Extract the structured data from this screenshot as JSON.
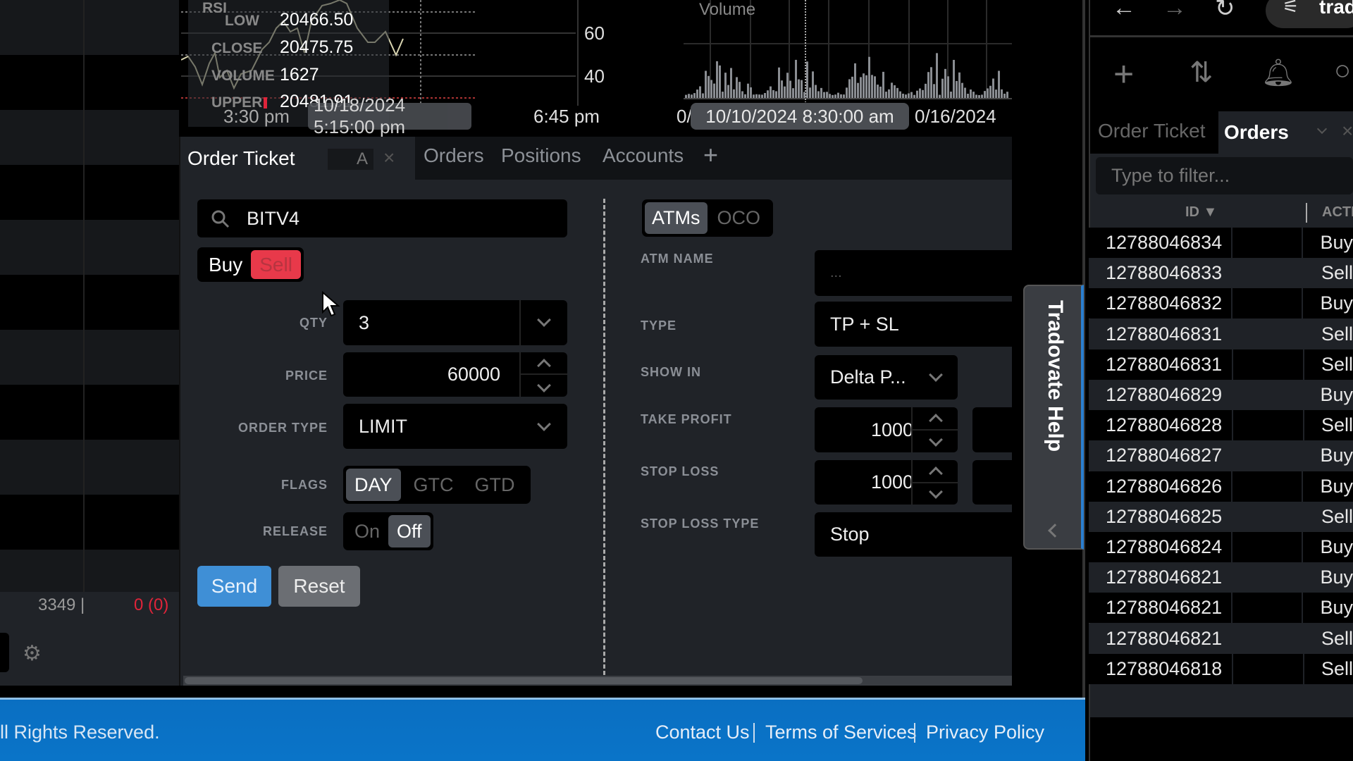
{
  "chart_rsi": {
    "title": "RSI",
    "legend": [
      {
        "label": "LOW",
        "value": "20466.50"
      },
      {
        "label": "CLOSE",
        "value": "20475.75"
      },
      {
        "label": "VOLUME",
        "value": "1627"
      },
      {
        "label": "UPPER",
        "value": "20481.91"
      }
    ],
    "y_ticks": [
      "60",
      "40"
    ],
    "x_ticks": [
      "3:30 pm",
      "6:45 pm"
    ],
    "crosshair_label": "10/18/2024 5:15:00 pm"
  },
  "chart_volume": {
    "title": "Volume",
    "x_ticks": [
      "0/",
      "0/16/2024"
    ],
    "crosshair_label": "10/10/2024 8:30:00 am"
  },
  "left_panel": {
    "count": "3349 |",
    "pnl": "0 (0)",
    "pnl_color": "#e0243a"
  },
  "order_panel": {
    "tabs": [
      {
        "label": "Order Ticket",
        "active": true
      },
      {
        "label": "Orders"
      },
      {
        "label": "Positions"
      },
      {
        "label": "Accounts"
      }
    ],
    "tab_badge": "A",
    "add_tab": "+",
    "close_tab": "×",
    "symbol": "BITV4",
    "side": {
      "buy": "Buy",
      "sell": "Sell",
      "selected": "Sell",
      "sell_color": "#e8394a"
    },
    "qty": {
      "label": "QTY",
      "value": "3"
    },
    "price": {
      "label": "PRICE",
      "value": "60000"
    },
    "order_type": {
      "label": "ORDER TYPE",
      "value": "LIMIT"
    },
    "flags": {
      "label": "FLAGS",
      "options": [
        "DAY",
        "GTC",
        "GTD"
      ],
      "selected": "DAY"
    },
    "release": {
      "label": "RELEASE",
      "options": [
        "On",
        "Off"
      ],
      "selected": "Off"
    },
    "send": "Send",
    "reset": "Reset",
    "send_color": "#3f8fd6"
  },
  "atm": {
    "toggle": [
      "ATMs",
      "OCO"
    ],
    "selected": "ATMs",
    "atm_name": {
      "label": "ATM NAME",
      "placeholder": "..."
    },
    "type": {
      "label": "TYPE",
      "value": "TP + SL"
    },
    "show_in": {
      "label": "SHOW IN",
      "value": "Delta P..."
    },
    "take_profit": {
      "label": "TAKE PROFIT",
      "value": "1000"
    },
    "stop_loss": {
      "label": "STOP LOSS",
      "value": "1000"
    },
    "stop_loss_type": {
      "label": "STOP LOSS TYPE",
      "value": "Stop"
    }
  },
  "help_tab": {
    "label": "Tradovate Help"
  },
  "footer": {
    "copyright": "ll Rights Reserved.",
    "links": [
      "Contact Us",
      "Terms of Services",
      "Privacy Policy"
    ],
    "color": "#0a6fc2"
  },
  "right_panel": {
    "url": "trad",
    "tabs": [
      {
        "label": "Order Ticket"
      },
      {
        "label": "Orders",
        "active": true
      }
    ],
    "filter_placeholder": "Type to filter...",
    "columns": [
      "ID ▼",
      "ACTI"
    ],
    "rows": [
      {
        "id": "12788046834",
        "action": "Buy"
      },
      {
        "id": "12788046833",
        "action": "Sell"
      },
      {
        "id": "12788046832",
        "action": "Buy"
      },
      {
        "id": "12788046831",
        "action": "Sell"
      },
      {
        "id": "12788046831",
        "action": "Sell"
      },
      {
        "id": "12788046829",
        "action": "Buy"
      },
      {
        "id": "12788046828",
        "action": "Sell"
      },
      {
        "id": "12788046827",
        "action": "Buy"
      },
      {
        "id": "12788046826",
        "action": "Buy"
      },
      {
        "id": "12788046825",
        "action": "Sell"
      },
      {
        "id": "12788046824",
        "action": "Buy"
      },
      {
        "id": "12788046821",
        "action": "Buy"
      },
      {
        "id": "12788046821",
        "action": "Buy"
      },
      {
        "id": "12788046821",
        "action": "Sell"
      },
      {
        "id": "12788046818",
        "action": "Sell"
      }
    ]
  }
}
